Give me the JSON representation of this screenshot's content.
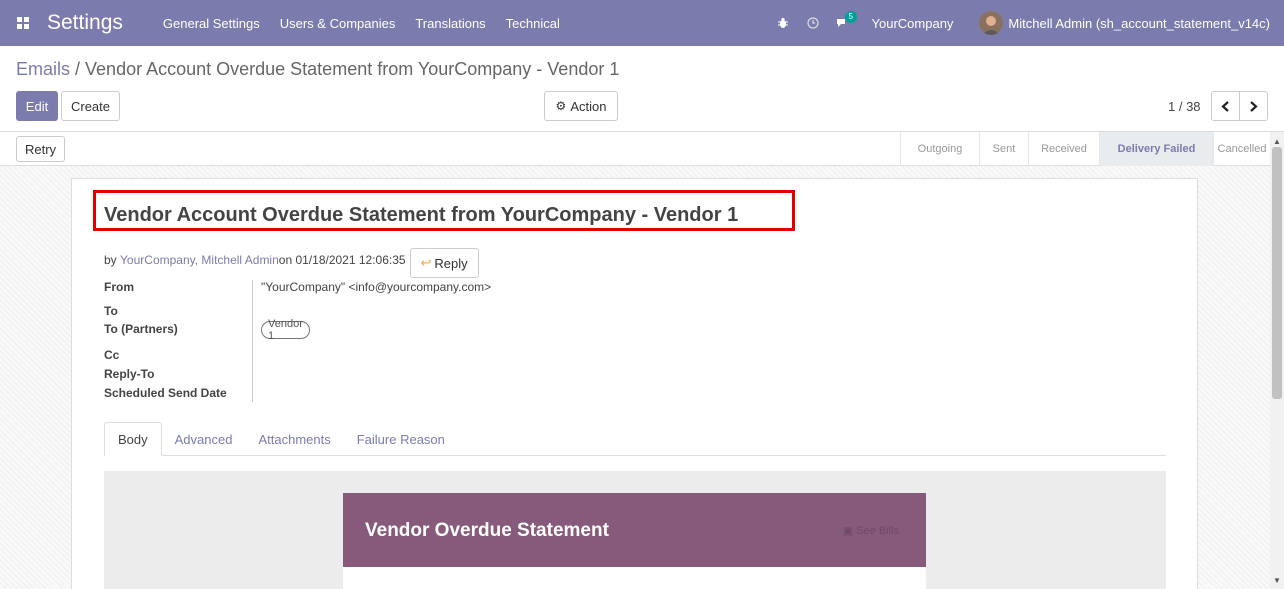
{
  "navbar": {
    "apps_icon": "apps-grid-icon",
    "brand": "Settings",
    "menu": [
      "General Settings",
      "Users & Companies",
      "Translations",
      "Technical"
    ],
    "bug_icon": "bug-icon",
    "clock_icon": "clock-icon",
    "chat_icon": "chat-icon",
    "message_count": "5",
    "company": "YourCompany",
    "user": "Mitchell Admin (sh_account_statement_v14c)",
    "color": "#7c7bad"
  },
  "control_panel": {
    "breadcrumb_parent": "Emails",
    "breadcrumb_separator": " / ",
    "breadcrumb_current": "Vendor Account Overdue Statement from YourCompany - Vendor 1",
    "edit_label": "Edit",
    "create_label": "Create",
    "action_label": "Action",
    "pager": "1 / 38"
  },
  "statusbar": {
    "retry_label": "Retry",
    "stages": [
      "Outgoing",
      "Sent",
      "Received",
      "Delivery Failed",
      "Cancelled"
    ],
    "active_stage": "Delivery Failed"
  },
  "email": {
    "subject": "Vendor Account Overdue Statement from YourCompany - Vendor 1",
    "by_prefix": "by ",
    "author": "YourCompany, Mitchell Admin",
    "date_text": " on 01/18/2021 12:06:35",
    "reply_label": "Reply",
    "fields": {
      "from_label": "From",
      "from_value": "\"YourCompany\" <info@yourcompany.com>",
      "to_label": "To",
      "to_partners_label": "To (Partners)",
      "to_partners_value": "Vendor 1",
      "cc_label": "Cc",
      "reply_to_label": "Reply-To",
      "scheduled_label": "Scheduled Send Date"
    },
    "tabs": [
      "Body",
      "Advanced",
      "Attachments",
      "Failure Reason"
    ],
    "active_tab": "Body",
    "preview": {
      "title": "Vendor Overdue Statement",
      "header_color": "#875a7b",
      "link_text": "▣ See Bills"
    }
  }
}
